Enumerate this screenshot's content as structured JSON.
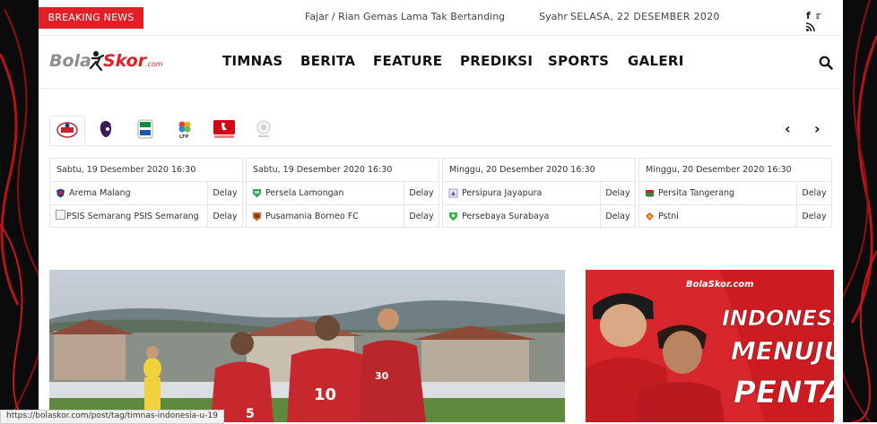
{
  "topbar": {
    "breaking_label": "BREAKING NEWS",
    "ticker_headline": "Fajar / Rian Gemas Lama Tak Bertanding",
    "ticker_next": "Syahr",
    "date": "SELASA, 22 DESEMBER 2020",
    "social": [
      "facebook-icon",
      "twitter-icon",
      "rss-icon"
    ]
  },
  "logo": {
    "text_a": "Bola",
    "text_b": "Skor",
    "text_c": ".com"
  },
  "nav": {
    "items": [
      "TIMNAS",
      "BERITA",
      "FEATURE",
      "PREDIKSI",
      "SPORTS",
      "GALERI"
    ]
  },
  "leagues": {
    "items": [
      "liga-1-indonesia-icon",
      "premier-league-icon",
      "serie-a-icon",
      "laliga-icon",
      "bundesliga-icon",
      "ligue-1-icon"
    ]
  },
  "matches": [
    {
      "datetime": "Sabtu, 19 Desember 2020 16:30",
      "home": "Arema Malang",
      "home_status": "Delay",
      "away": "PSIS Semarang PSIS Semarang",
      "away_status": "Delay"
    },
    {
      "datetime": "Sabtu, 19 Desember 2020 16:30",
      "home": "Persela Lamongan",
      "home_status": "Delay",
      "away": "Pusamania Borneo FC",
      "away_status": "Delay"
    },
    {
      "datetime": "Minggu, 20 Desember 2020 16:30",
      "home": "Persipura Jayapura",
      "home_status": "Delay",
      "away": "Persebaya Surabaya",
      "away_status": "Delay"
    },
    {
      "datetime": "Minggu, 20 Desember 2020 16:30",
      "home": "Persita Tangerang",
      "home_status": "Delay",
      "away": "Pstni",
      "away_status": "Delay"
    }
  ],
  "promo": {
    "logo": "BolaSkor.com",
    "line1": "INDONESIA",
    "line2": "MENUJU",
    "line3": "PENTAS"
  },
  "statusbar": {
    "url": "https://bolaskor.com/post/tag/timnas-indonesia-u-19"
  },
  "colors": {
    "brand_red": "#e21f26",
    "text": "#222222",
    "promo_red": "#d7262c"
  }
}
